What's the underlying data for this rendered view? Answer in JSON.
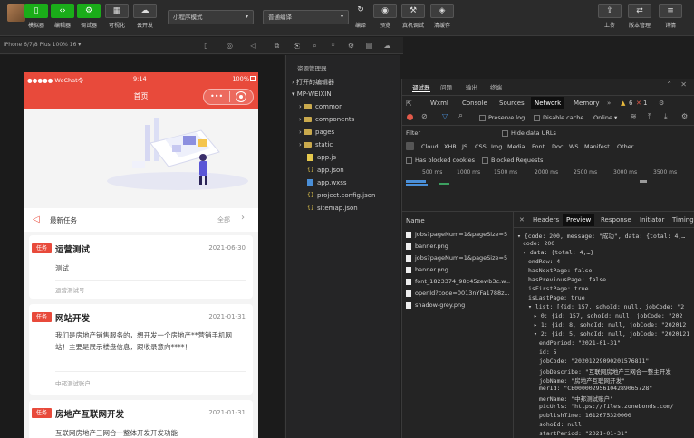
{
  "toolbar": {
    "buttons_left": [
      {
        "label": "模拟器",
        "icon": "phone-icon"
      },
      {
        "label": "编辑器",
        "icon": "code-icon"
      },
      {
        "label": "调试器",
        "icon": "debug-icon"
      },
      {
        "label": "可视化",
        "icon": "grid-icon"
      },
      {
        "label": "云开发",
        "icon": "cloud-icon"
      }
    ],
    "mode_select": "小程序模式",
    "compile_select": "普通编译",
    "buttons_mid": [
      {
        "label": "编译",
        "icon": "refresh-icon"
      },
      {
        "label": "预览",
        "icon": "eye-icon"
      },
      {
        "label": "真机调试",
        "icon": "device-debug-icon"
      },
      {
        "label": "清缓存",
        "icon": "layers-icon"
      }
    ],
    "buttons_right": [
      {
        "label": "上传",
        "icon": "upload-icon"
      },
      {
        "label": "版本管理",
        "icon": "version-icon"
      },
      {
        "label": "详情",
        "icon": "menu-icon"
      }
    ]
  },
  "device_label": "iPhone 6/7/8 Plus 100% 16 ▾",
  "phone": {
    "carrier": "●●●●● WeChat令",
    "time": "9:14",
    "battery": "100%",
    "nav_title": "首页",
    "notice_title": "最新任务",
    "notice_more": "全部",
    "cards": [
      {
        "badge": "任务",
        "title": "运营测试",
        "date": "2021-06-30",
        "desc": "测试",
        "company": "运营测试号"
      },
      {
        "badge": "任务",
        "title": "网站开发",
        "date": "2021-01-31",
        "desc": "我们是房地产销售服务的，想开发一个房地产**营销手机网站！主要是展示楼盘信息，跟收录意向****！",
        "company": "中邦测试账户"
      },
      {
        "badge": "任务",
        "title": "房地产互联网开发",
        "date": "2021-01-31",
        "desc": "互联网房地产三网合一整体开发开发功能"
      }
    ]
  },
  "explorer": {
    "title": "资源管理器",
    "open_editors": "打开的编辑器",
    "project": "MP-WEIXIN",
    "items": [
      {
        "name": "common",
        "type": "folder"
      },
      {
        "name": "components",
        "type": "folder"
      },
      {
        "name": "pages",
        "type": "folder"
      },
      {
        "name": "static",
        "type": "folder"
      },
      {
        "name": "app.js",
        "type": "js"
      },
      {
        "name": "app.json",
        "type": "json"
      },
      {
        "name": "app.wxss",
        "type": "wxss"
      },
      {
        "name": "project.config.json",
        "type": "json"
      },
      {
        "name": "sitemap.json",
        "type": "json"
      }
    ]
  },
  "devtools": {
    "top_tabs": [
      "调试器",
      "问题",
      "输出",
      "终端"
    ],
    "tabs": [
      "Wxml",
      "Console",
      "Sources",
      "Network",
      "Memory"
    ],
    "active_tab": "Network",
    "badge_warn": "6",
    "badge_err": "1",
    "preserve_log": "Preserve log",
    "disable_cache": "Disable cache",
    "throttle": "Online",
    "filter_label": "Filter",
    "hide_data_urls": "Hide data URLs",
    "types": [
      "Cloud",
      "XHR",
      "JS",
      "CSS",
      "Img",
      "Media",
      "Font",
      "Doc",
      "WS",
      "Manifest",
      "Other"
    ],
    "has_blocked_cookies": "Has blocked cookies",
    "blocked_requests": "Blocked Requests",
    "timeline": [
      "500 ms",
      "1000 ms",
      "1500 ms",
      "2000 ms",
      "2500 ms",
      "3000 ms",
      "3500 ms"
    ],
    "name_header": "Name",
    "requests": [
      "jobs?pageNum=1&pageSize=5",
      "banner.png",
      "jobs?pageNum=1&pageSize=5",
      "banner.png",
      "font_1823374_98c45zewb3c.w...",
      "openId?code=0013nYFa1788z...",
      "shadow-grey.png"
    ],
    "preview_tabs": [
      "Headers",
      "Preview",
      "Response",
      "Initiator",
      "Timing"
    ],
    "active_preview": "Preview",
    "preview_lines": [
      {
        "i": 0,
        "t": "▾ {code: 200, message: \"成功\", data: {total: 4,…"
      },
      {
        "i": 1,
        "t": "code: 200"
      },
      {
        "i": 1,
        "t": "▾ data: {total: 4,…}"
      },
      {
        "i": 2,
        "t": "endRow: 4"
      },
      {
        "i": 2,
        "t": "hasNextPage: false"
      },
      {
        "i": 2,
        "t": "hasPreviousPage: false"
      },
      {
        "i": 2,
        "t": "isFirstPage: true"
      },
      {
        "i": 2,
        "t": "isLastPage: true"
      },
      {
        "i": 2,
        "t": "▾ list: [{id: 157, sohoId: null, jobCode: \"2"
      },
      {
        "i": 3,
        "t": "▸ 0: {id: 157, sohoId: null, jobCode: \"202"
      },
      {
        "i": 3,
        "t": "▸ 1: {id: 8, sohoId: null, jobCode: \"202012"
      },
      {
        "i": 3,
        "t": "▾ 2: {id: 5, sohoId: null, jobCode: \"2020121"
      },
      {
        "i": 4,
        "t": "endPeriod: \"2021-01-31\""
      },
      {
        "i": 4,
        "t": "id: 5"
      },
      {
        "i": 4,
        "t": "jobCode: \"20201229090201576811\""
      },
      {
        "i": 4,
        "t": "jobDescribe: \"互联网房地产三网合一整主开发"
      },
      {
        "i": 4,
        "t": "jobName: \"房地产互联网开发\""
      },
      {
        "i": 4,
        "t": "merId: \"CE000002956104289065728\""
      },
      {
        "i": 4,
        "t": "merName: \"中邦测试账户\""
      },
      {
        "i": 4,
        "t": "picUrls: \"https://files.zonebonds.com/"
      },
      {
        "i": 4,
        "t": "publishTime: 1612675320000"
      },
      {
        "i": 4,
        "t": "sohoId: null"
      },
      {
        "i": 4,
        "t": "startPeriod: \"2021-01-31\""
      }
    ]
  }
}
